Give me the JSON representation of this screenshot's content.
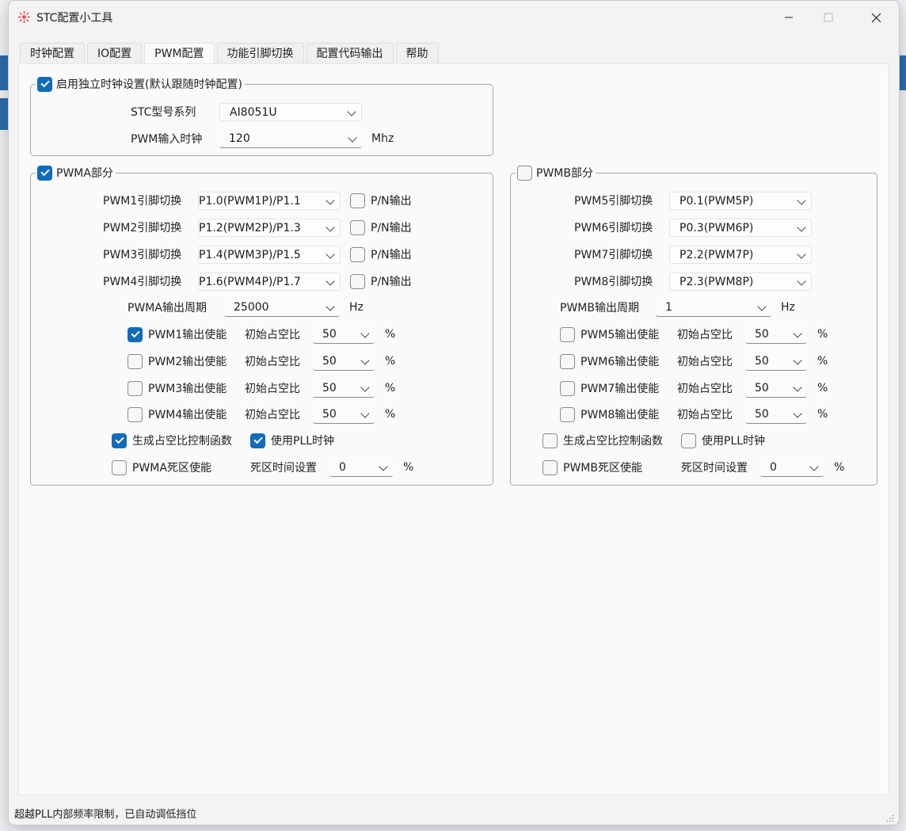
{
  "window": {
    "title": "STC配置小工具"
  },
  "tabs": [
    {
      "label": "时钟配置",
      "active": false
    },
    {
      "label": "IO配置",
      "active": false
    },
    {
      "label": "PWM配置",
      "active": true
    },
    {
      "label": "功能引脚切换",
      "active": false
    },
    {
      "label": "配置代码输出",
      "active": false
    },
    {
      "label": "帮助",
      "active": false
    }
  ],
  "clock_group": {
    "title": "启用独立时钟设置(默认跟随时钟配置)",
    "checked": true,
    "model_label": "STC型号系列",
    "model_value": "AI8051U",
    "input_clock_label": "PWM输入时钟",
    "input_clock_value": "120",
    "input_clock_unit": "Mhz"
  },
  "pwma": {
    "title": "PWMA部分",
    "checked": true,
    "pins": [
      {
        "label": "PWM1引脚切换",
        "value": "P1.0(PWM1P)/P1.1",
        "pn_label": "P/N输出"
      },
      {
        "label": "PWM2引脚切换",
        "value": "P1.2(PWM2P)/P1.3",
        "pn_label": "P/N输出"
      },
      {
        "label": "PWM3引脚切换",
        "value": "P1.4(PWM3P)/P1.5",
        "pn_label": "P/N输出"
      },
      {
        "label": "PWM4引脚切换",
        "value": "P1.6(PWM4P)/P1.7",
        "pn_label": "P/N输出"
      }
    ],
    "period_label": "PWMA输出周期",
    "period_value": "25000",
    "period_unit": "Hz",
    "channels": [
      {
        "label": "PWM1输出使能",
        "checked": true,
        "duty_label": "初始占空比",
        "duty": "50",
        "unit": "%"
      },
      {
        "label": "PWM2输出使能",
        "checked": false,
        "duty_label": "初始占空比",
        "duty": "50",
        "unit": "%"
      },
      {
        "label": "PWM3输出使能",
        "checked": false,
        "duty_label": "初始占空比",
        "duty": "50",
        "unit": "%"
      },
      {
        "label": "PWM4输出使能",
        "checked": false,
        "duty_label": "初始占空比",
        "duty": "50",
        "unit": "%"
      }
    ],
    "gen_func_label": "生成占空比控制函数",
    "gen_func_checked": true,
    "pll_label": "使用PLL时钟",
    "pll_checked": true,
    "deadzone_label": "PWMA死区使能",
    "deadzone_checked": false,
    "deadtime_label": "死区时间设置",
    "deadtime_value": "0",
    "deadtime_unit": "%"
  },
  "pwmb": {
    "title": "PWMB部分",
    "checked": false,
    "pins": [
      {
        "label": "PWM5引脚切换",
        "value": "P0.1(PWM5P)"
      },
      {
        "label": "PWM6引脚切换",
        "value": "P0.3(PWM6P)"
      },
      {
        "label": "PWM7引脚切换",
        "value": "P2.2(PWM7P)"
      },
      {
        "label": "PWM8引脚切换",
        "value": "P2.3(PWM8P)"
      }
    ],
    "period_label": "PWMB输出周期",
    "period_value": "1",
    "period_unit": "Hz",
    "channels": [
      {
        "label": "PWM5输出使能",
        "checked": false,
        "duty_label": "初始占空比",
        "duty": "50",
        "unit": "%"
      },
      {
        "label": "PWM6输出使能",
        "checked": false,
        "duty_label": "初始占空比",
        "duty": "50",
        "unit": "%"
      },
      {
        "label": "PWM7输出使能",
        "checked": false,
        "duty_label": "初始占空比",
        "duty": "50",
        "unit": "%"
      },
      {
        "label": "PWM8输出使能",
        "checked": false,
        "duty_label": "初始占空比",
        "duty": "50",
        "unit": "%"
      }
    ],
    "gen_func_label": "生成占空比控制函数",
    "gen_func_checked": false,
    "pll_label": "使用PLL时钟",
    "pll_checked": false,
    "deadzone_label": "PWMB死区使能",
    "deadzone_checked": false,
    "deadtime_label": "死区时间设置",
    "deadtime_value": "0",
    "deadtime_unit": "%"
  },
  "status": {
    "text": "超越PLL内部频率限制，已自动调低挡位"
  },
  "colors": {
    "accent": "#0f6cbd",
    "border": "#a6a6a6",
    "panel": "#fafafa"
  },
  "icons": {
    "app": "app-icon",
    "minimize": "minimize-icon",
    "maximize": "maximize-icon",
    "close": "close-icon",
    "chevron": "chevron-down-icon"
  }
}
